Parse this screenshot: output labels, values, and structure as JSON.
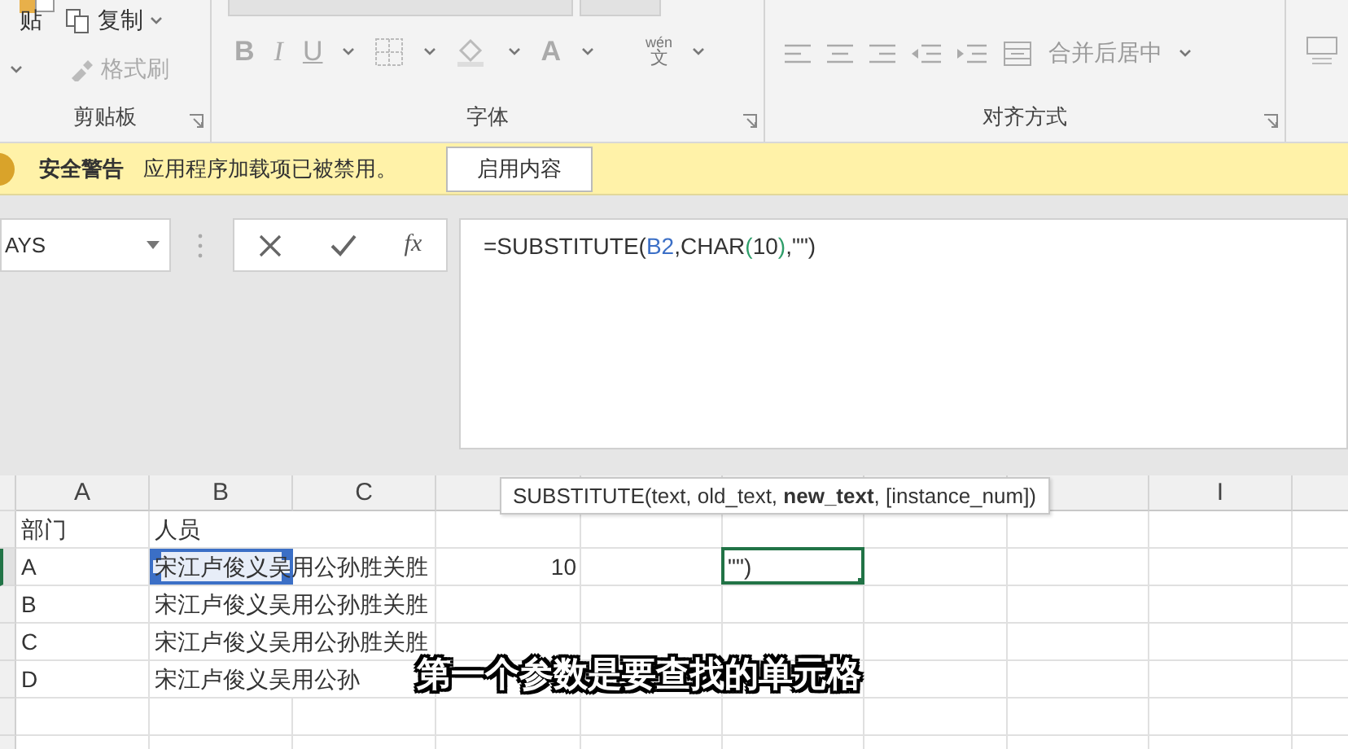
{
  "ribbon": {
    "clipboard": {
      "paste_label": "贴",
      "copy_label": "复制",
      "format_painter_label": "格式刷",
      "group_label": "剪贴板"
    },
    "font": {
      "style_buttons": [
        "B",
        "I",
        "U"
      ],
      "font_color_label": "A",
      "phonetic_top": "wén",
      "phonetic_char": "文",
      "group_label": "字体"
    },
    "alignment": {
      "merge_label": "合并后居中",
      "group_label": "对齐方式"
    }
  },
  "security_bar": {
    "title": "安全警告",
    "message": "应用程序加载项已被禁用。",
    "button": "启用内容"
  },
  "name_box": {
    "value": "AYS"
  },
  "formula_bar": {
    "fx_label": "fx",
    "parts": [
      {
        "text": "=SUBSTITUTE(",
        "color": "#333333"
      },
      {
        "text": "B2",
        "color": "#3b6fc6"
      },
      {
        "text": ",CHAR",
        "color": "#333333"
      },
      {
        "text": "(",
        "color": "#2f9e6a"
      },
      {
        "text": "10",
        "color": "#333333"
      },
      {
        "text": ")",
        "color": "#2f9e6a"
      },
      {
        "text": ",\"\")",
        "color": "#333333"
      }
    ]
  },
  "tooltip": {
    "text": "SUBSTITUTE(text, old_text, **new_text**, [instance_num])"
  },
  "sheet": {
    "columns": [
      {
        "label": "A"
      },
      {
        "label": "B"
      },
      {
        "label": "C"
      },
      {},
      {},
      {},
      {},
      {},
      {
        "label": "I"
      },
      {}
    ],
    "rows": [
      {
        "selected": false,
        "cells": [
          {
            "text": "部门"
          },
          {
            "text": "人员"
          },
          null,
          null,
          null,
          null,
          null,
          null,
          null,
          null
        ]
      },
      {
        "selected": true,
        "cells": [
          {
            "text": "A"
          },
          {
            "text": "宋江卢俊义吴用公孙胜关胜",
            "referenced": true
          },
          null,
          {
            "text": "10",
            "right_aligned": true
          },
          null,
          {
            "text": "\"\")",
            "active": true
          },
          null,
          null,
          null,
          null
        ]
      },
      {
        "selected": false,
        "cells": [
          {
            "text": "B"
          },
          {
            "text": "宋江卢俊义吴用公孙胜关胜"
          },
          null,
          null,
          null,
          null,
          null,
          null,
          null,
          null
        ]
      },
      {
        "selected": false,
        "cells": [
          {
            "text": "C"
          },
          {
            "text": "宋江卢俊义吴用公孙胜关胜"
          },
          null,
          null,
          null,
          null,
          null,
          null,
          null,
          null
        ]
      },
      {
        "selected": false,
        "cells": [
          {
            "text": "D"
          },
          {
            "text": "宋江卢俊义吴用公孙"
          },
          null,
          null,
          null,
          null,
          null,
          null,
          null,
          null
        ]
      },
      {
        "selected": false,
        "cells": [
          null,
          null,
          null,
          null,
          null,
          null,
          null,
          null,
          null,
          null
        ]
      },
      {
        "selected": false,
        "cells": [
          null,
          null,
          null,
          null,
          null,
          null,
          null,
          null,
          null,
          null
        ]
      }
    ]
  },
  "subtitle": "第一个参数是要查找的单元格"
}
